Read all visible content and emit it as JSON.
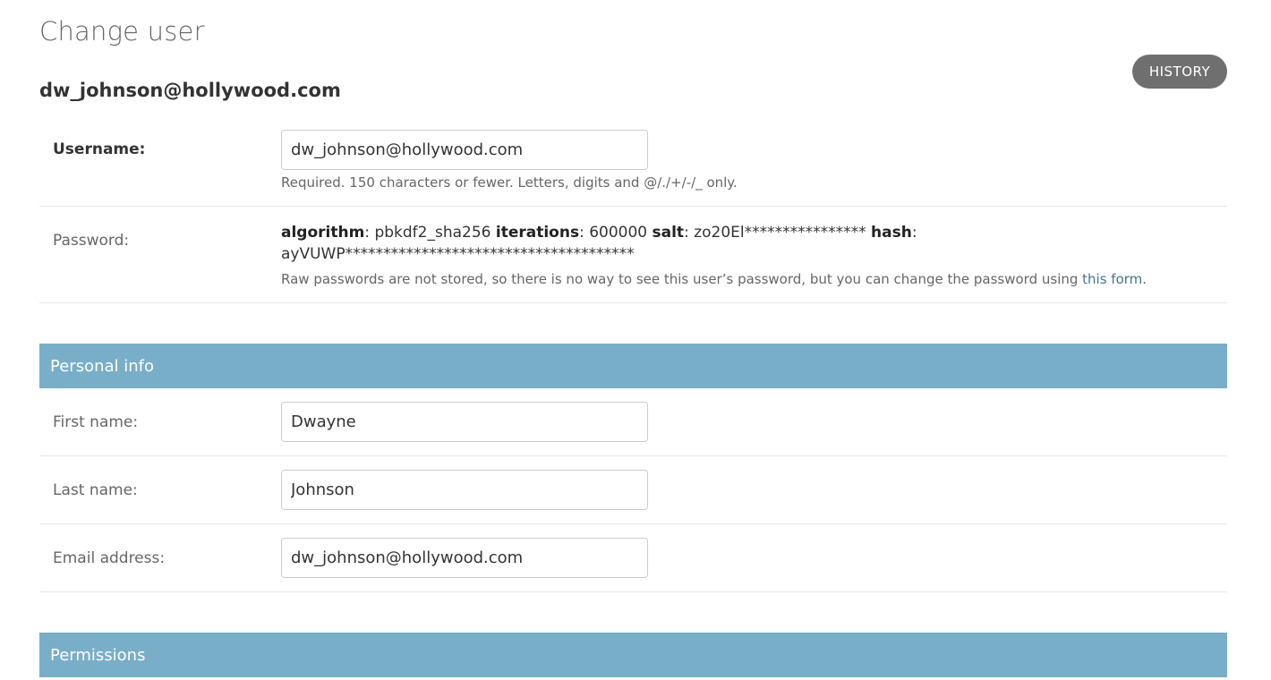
{
  "page": {
    "title": "Change user",
    "object_title": "dw_johnson@hollywood.com",
    "history_label": "HISTORY"
  },
  "username": {
    "label": "Username:",
    "value": "dw_johnson@hollywood.com",
    "help": "Required. 150 characters or fewer. Letters, digits and @/./+/-/_ only."
  },
  "password": {
    "label": "Password:",
    "algorithm_key": "algorithm",
    "algorithm_value": ": pbkdf2_sha256 ",
    "iterations_key": "iterations",
    "iterations_value": ": 600000 ",
    "salt_key": "salt",
    "salt_value": ": zo20El**************** ",
    "hash_key": "hash",
    "hash_value": ": ayVUWP**************************************",
    "help_prefix": "Raw passwords are not stored, so there is no way to see this user’s password, but you can change the password using ",
    "help_link": "this form",
    "help_suffix": "."
  },
  "personal_info": {
    "header": "Personal info",
    "first_name": {
      "label": "First name:",
      "value": "Dwayne"
    },
    "last_name": {
      "label": "Last name:",
      "value": "Johnson"
    },
    "email": {
      "label": "Email address:",
      "value": "dw_johnson@hollywood.com"
    }
  },
  "permissions": {
    "header": "Permissions"
  },
  "colors": {
    "header_bg": "#79aec8",
    "link": "#417690",
    "history_bg": "#6f6f6f"
  }
}
